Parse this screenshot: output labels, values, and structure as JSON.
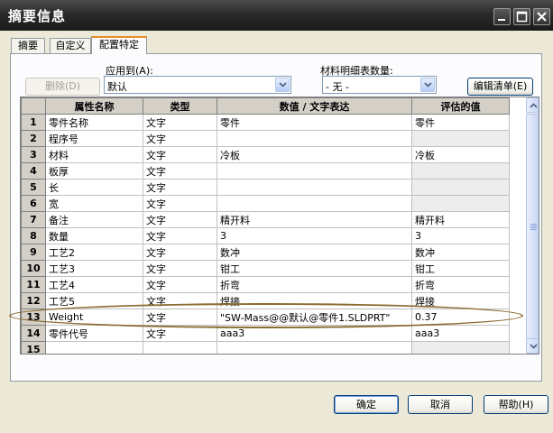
{
  "window": {
    "title": "摘要信息"
  },
  "tabs": [
    {
      "label": "摘要"
    },
    {
      "label": "自定义"
    },
    {
      "label": "配置特定"
    }
  ],
  "controls": {
    "delete_button": "删除(D)",
    "apply_to_label": "应用到(A):",
    "apply_to_value": "默认",
    "bom_qty_label": "材料明细表数量:",
    "bom_qty_value": "- 无 -",
    "edit_list_button": "编辑清单(E)"
  },
  "table": {
    "columns": [
      "属性名称",
      "类型",
      "数值 / 文字表达",
      "评估的值"
    ],
    "rows": [
      {
        "num": "1",
        "name": "零件名称",
        "type": "文字",
        "value": "零件",
        "evaluated": "零件"
      },
      {
        "num": "2",
        "name": "程序号",
        "type": "文字",
        "value": "",
        "evaluated": ""
      },
      {
        "num": "3",
        "name": "材料",
        "type": "文字",
        "value": "冷板",
        "evaluated": "冷板"
      },
      {
        "num": "4",
        "name": "板厚",
        "type": "文字",
        "value": "",
        "evaluated": ""
      },
      {
        "num": "5",
        "name": "长",
        "type": "文字",
        "value": "",
        "evaluated": ""
      },
      {
        "num": "6",
        "name": "宽",
        "type": "文字",
        "value": "",
        "evaluated": ""
      },
      {
        "num": "7",
        "name": "备注",
        "type": "文字",
        "value": "精开料",
        "evaluated": "精开料"
      },
      {
        "num": "8",
        "name": "数量",
        "type": "文字",
        "value": "3",
        "evaluated": "3"
      },
      {
        "num": "9",
        "name": "工艺2",
        "type": "文字",
        "value": "数冲",
        "evaluated": "数冲"
      },
      {
        "num": "10",
        "name": "工艺3",
        "type": "文字",
        "value": "钳工",
        "evaluated": "钳工"
      },
      {
        "num": "11",
        "name": "工艺4",
        "type": "文字",
        "value": "折弯",
        "evaluated": "折弯"
      },
      {
        "num": "12",
        "name": "工艺5",
        "type": "文字",
        "value": "焊接",
        "evaluated": "焊接"
      },
      {
        "num": "13",
        "name": "Weight",
        "type": "文字",
        "value": "\"SW-Mass@@默认@零件1.SLDPRT\"",
        "evaluated": "0.37"
      },
      {
        "num": "14",
        "name": "零件代号",
        "type": "文字",
        "value": "aaa3",
        "evaluated": "aaa3"
      },
      {
        "num": "15",
        "name": "",
        "type": "",
        "value": "",
        "evaluated": ""
      }
    ]
  },
  "footer": {
    "ok": "确定",
    "cancel": "取消",
    "help": "帮助(H)"
  },
  "colors": {
    "annotation_ellipse": "#8b6a2f",
    "active_tab_accent": "#e68b2c"
  }
}
